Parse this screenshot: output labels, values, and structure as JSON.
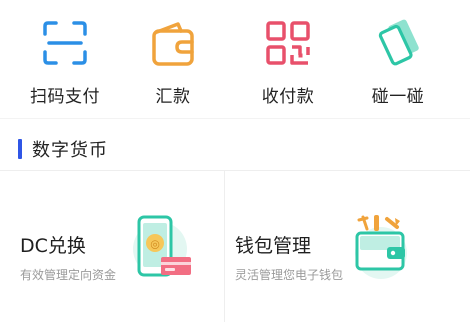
{
  "quick_actions": [
    {
      "label": "扫码支付",
      "icon": "scan-icon",
      "color": "#2b8fe6"
    },
    {
      "label": "汇款",
      "icon": "wallet-icon",
      "color": "#f0a33c"
    },
    {
      "label": "收付款",
      "icon": "qr-code-icon",
      "color": "#e8506b"
    },
    {
      "label": "碰一碰",
      "icon": "tap-phone-icon",
      "color": "#2dc6a6"
    }
  ],
  "section": {
    "title": "数字货币",
    "accent": "#2f56e6"
  },
  "cards": [
    {
      "title": "DC兑换",
      "subtitle": "有效管理定向资金",
      "icon": "phone-card-exchange-icon"
    },
    {
      "title": "钱包管理",
      "subtitle": "灵活管理您电子钱包",
      "icon": "wallet-tools-icon"
    }
  ]
}
